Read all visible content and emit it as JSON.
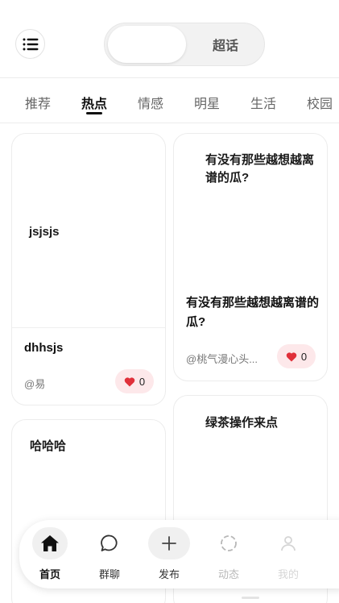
{
  "header": {
    "menu_icon": "hamburger-menu-icon",
    "segment": {
      "left_label": "",
      "right_label": "超话"
    }
  },
  "tabs": [
    {
      "label": "推荐",
      "active": false
    },
    {
      "label": "热点",
      "active": true
    },
    {
      "label": "情感",
      "active": false
    },
    {
      "label": "明星",
      "active": false
    },
    {
      "label": "生活",
      "active": false
    },
    {
      "label": "校园",
      "active": false
    }
  ],
  "cards": [
    {
      "cover_text": "jsjsjs",
      "title": "dhhsjs",
      "author": "@易",
      "likes": "0"
    },
    {
      "cover_text": "有没有那些越想越离谱的瓜?",
      "title": "有没有那些越想越离谱的瓜?",
      "author": "@桃气漫心头...",
      "likes": "0"
    },
    {
      "cover_text": "哈哈哈",
      "title": "",
      "author": "",
      "likes": ""
    },
    {
      "cover_text": "绿茶操作来点",
      "title": "",
      "author": "",
      "likes": ""
    }
  ],
  "bottom_nav": [
    {
      "label": "首页",
      "icon": "home-icon",
      "active": true
    },
    {
      "label": "群聊",
      "icon": "chat-bubble-icon",
      "active": false
    },
    {
      "label": "发布",
      "icon": "plus-icon",
      "active": false
    },
    {
      "label": "动态",
      "icon": "activity-icon",
      "active": false
    },
    {
      "label": "我的",
      "icon": "profile-icon",
      "active": false
    }
  ],
  "colors": {
    "like_bg": "#fde8ea",
    "heart": "#e0303a",
    "accent_text": "#111111"
  }
}
